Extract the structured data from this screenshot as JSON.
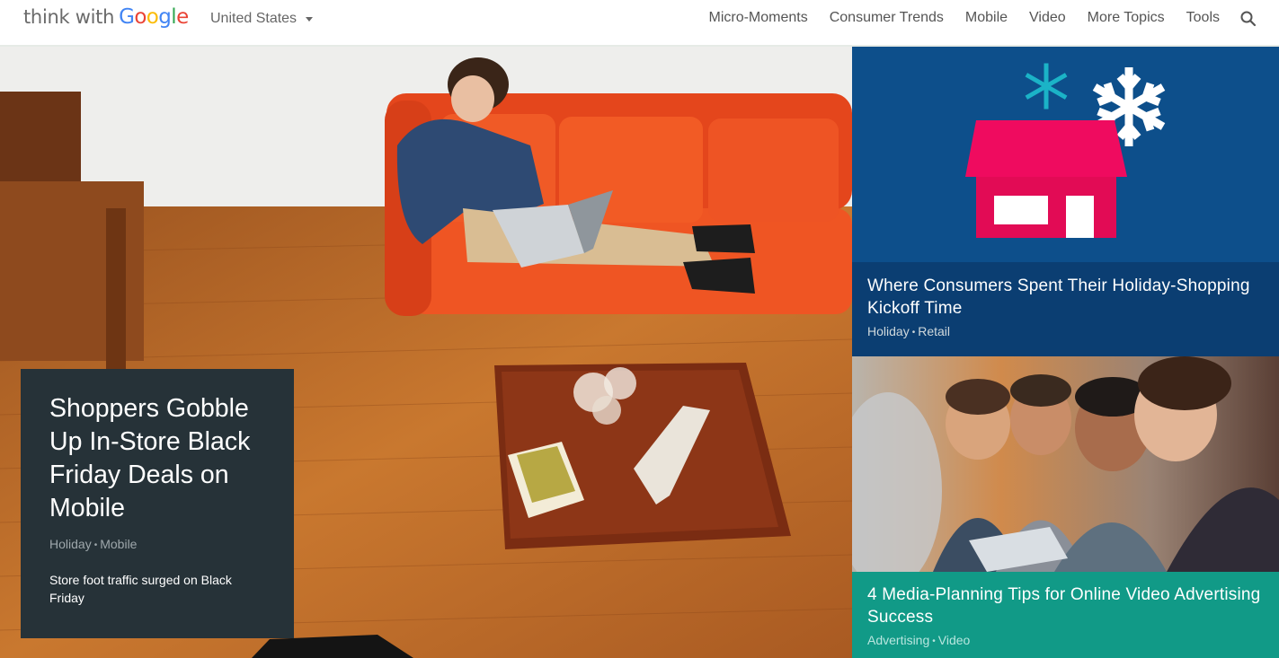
{
  "header": {
    "logo_prefix": "think with",
    "logo_google": [
      "G",
      "o",
      "o",
      "g",
      "l",
      "e"
    ],
    "country": "United States",
    "nav": [
      "Micro-Moments",
      "Consumer Trends",
      "Mobile",
      "Video",
      "More Topics",
      "Tools"
    ]
  },
  "hero": {
    "title": "Shoppers Gobble Up In-Store Black Friday Deals on Mobile",
    "tags": [
      "Holiday",
      "Mobile"
    ],
    "description": "Store foot traffic surged on Black Friday"
  },
  "tiles": [
    {
      "title": "Where Consumers Spent Their Holiday-Shopping Kickoff Time",
      "tags": [
        "Holiday",
        "Retail"
      ]
    },
    {
      "title": "4 Media-Planning Tips for Online Video Advertising Success",
      "tags": [
        "Advertising",
        "Video"
      ]
    }
  ],
  "colors": {
    "hero_card": "#263238",
    "tile1_bg": "#0d4f8b",
    "tile1_caption": "#0b3e72",
    "tile2_caption": "#119a87",
    "store_pink": "#ef0b5f",
    "snowflake_teal": "#1bb3c7"
  },
  "icons": [
    "search-icon",
    "caret-down-icon",
    "snowflake-icon",
    "store-icon"
  ]
}
